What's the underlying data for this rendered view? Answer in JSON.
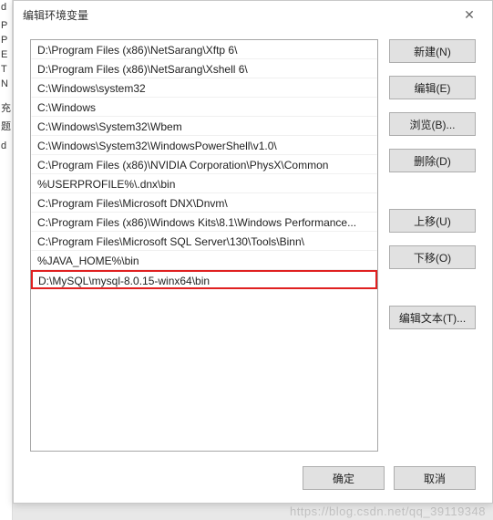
{
  "left_strip": [
    "d",
    "",
    "P",
    "P",
    "E",
    "T",
    "N",
    "",
    "",
    "充",
    "题",
    "",
    "d",
    ""
  ],
  "dialog": {
    "title": "编辑环境变量",
    "close_symbol": "✕"
  },
  "list_items": [
    "D:\\Program Files (x86)\\NetSarang\\Xftp 6\\",
    "D:\\Program Files (x86)\\NetSarang\\Xshell 6\\",
    "C:\\Windows\\system32",
    "C:\\Windows",
    "C:\\Windows\\System32\\Wbem",
    "C:\\Windows\\System32\\WindowsPowerShell\\v1.0\\",
    "C:\\Program Files (x86)\\NVIDIA Corporation\\PhysX\\Common",
    "%USERPROFILE%\\.dnx\\bin",
    "C:\\Program Files\\Microsoft DNX\\Dnvm\\",
    "C:\\Program Files (x86)\\Windows Kits\\8.1\\Windows Performance...",
    "C:\\Program Files\\Microsoft SQL Server\\130\\Tools\\Binn\\",
    "%JAVA_HOME%\\bin",
    "D:\\MySQL\\mysql-8.0.15-winx64\\bin"
  ],
  "highlighted_index": 12,
  "buttons": {
    "new": "新建(N)",
    "edit": "编辑(E)",
    "browse": "浏览(B)...",
    "delete": "删除(D)",
    "moveup": "上移(U)",
    "movedown": "下移(O)",
    "edittext": "编辑文本(T)..."
  },
  "footer": {
    "ok": "确定",
    "cancel": "取消"
  },
  "watermark": "https://blog.csdn.net/qq_39119348"
}
